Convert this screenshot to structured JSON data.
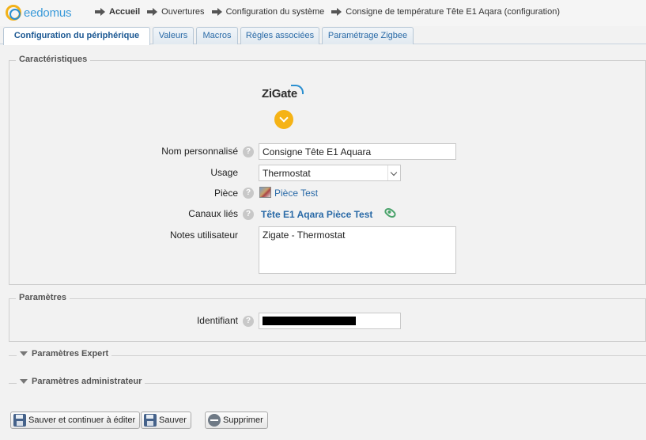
{
  "header": {
    "logo_text": "eedomus",
    "breadcrumbs": [
      "Accueil",
      "Ouvertures",
      "Configuration du système",
      "Consigne de température Tête E1 Aqara (configuration)"
    ]
  },
  "tabs": [
    "Configuration du périphérique",
    "Valeurs",
    "Macros",
    "Règles associées",
    "Paramétrage Zigbee"
  ],
  "active_tab": "Configuration du périphérique",
  "caracteristiques": {
    "legend": "Caractéristiques",
    "brand_logo": "ZiGate",
    "nom_label": "Nom personnalisé",
    "nom_value": "Consigne Tête E1 Aquara",
    "usage_label": "Usage",
    "usage_value": "Thermostat",
    "piece_label": "Pièce",
    "piece_value": "Pièce Test",
    "canaux_label": "Canaux liés",
    "canaux_value": "Tête E1 Aqara Pièce Test",
    "notes_label": "Notes utilisateur",
    "notes_value": "Zigate - Thermostat",
    "help_glyph": "?"
  },
  "parametres": {
    "legend": "Paramètres",
    "identifiant_label": "Identifiant"
  },
  "sections": {
    "expert": "Paramètres Expert",
    "admin": "Paramètres administrateur"
  },
  "buttons": {
    "save_continue": "Sauver et continuer à éditer",
    "save": "Sauver",
    "delete": "Supprimer"
  },
  "colors": {
    "link": "#2a6aa7",
    "accent_orange": "#f5b316",
    "eye_green": "#4aa36b"
  }
}
